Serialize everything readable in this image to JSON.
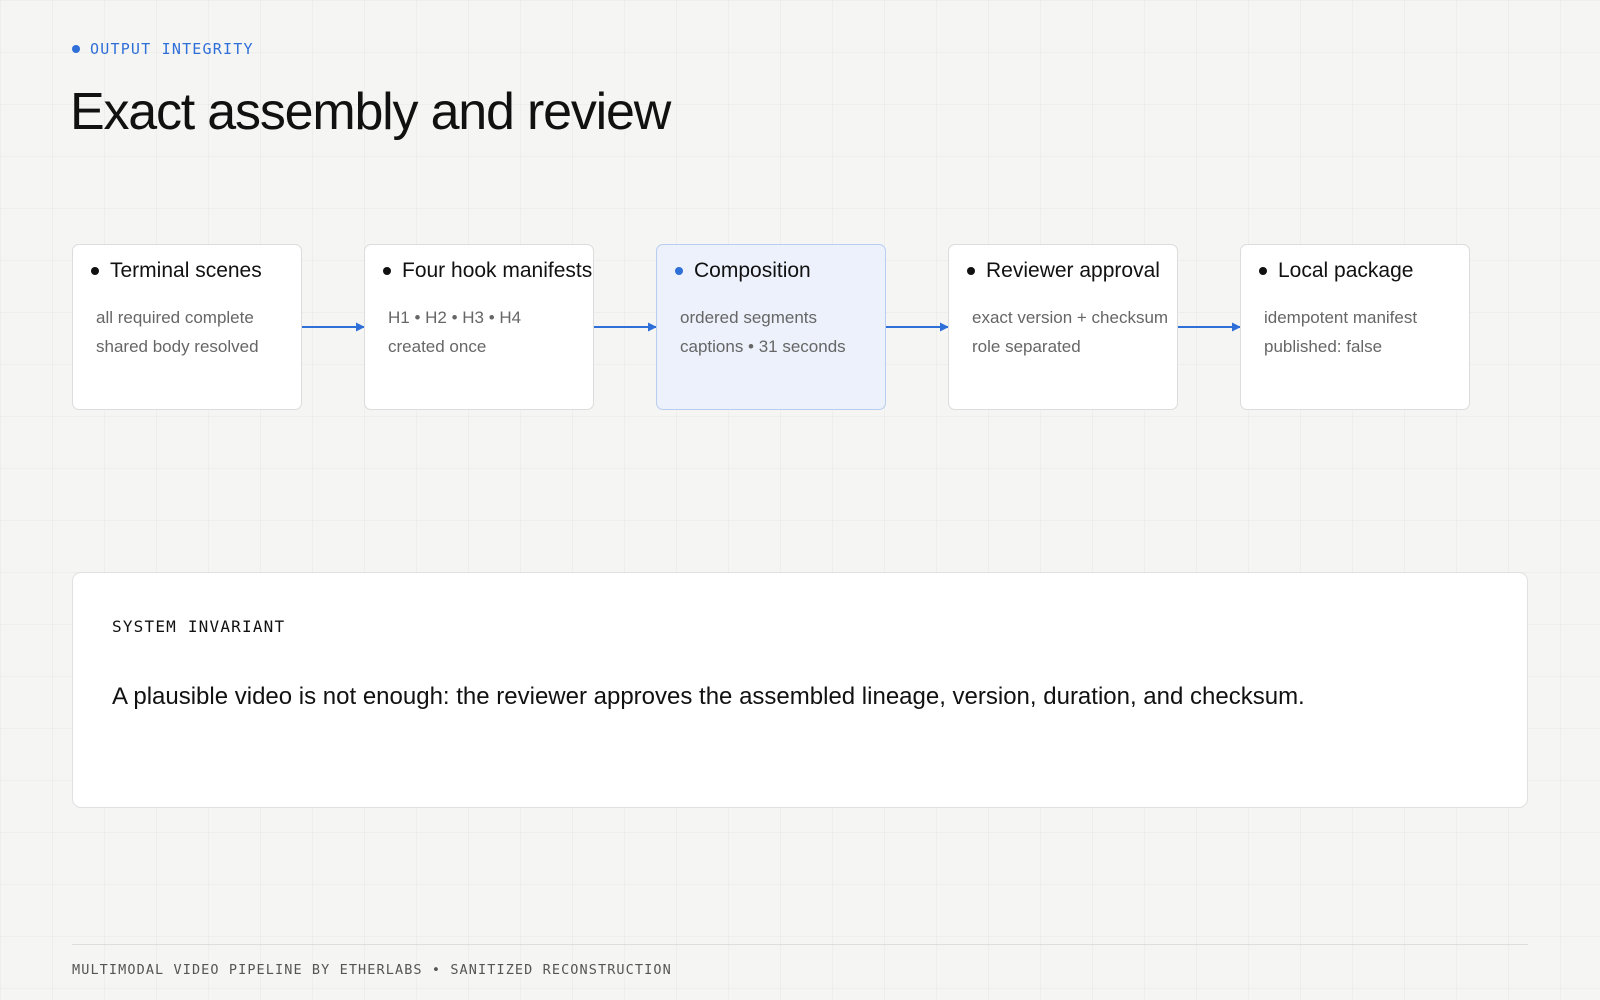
{
  "header": {
    "eyebrow": "OUTPUT INTEGRITY",
    "title": "Exact assembly and review"
  },
  "colors": {
    "accent": "#2f6fd8",
    "highlight_fill": "#ecf1fb",
    "highlight_border": "#b8cdef",
    "node_border": "#dcdcdc",
    "background": "#f5f5f3"
  },
  "pipeline": {
    "steps": [
      {
        "title": "Terminal scenes",
        "lines": [
          "all required complete",
          "shared body resolved"
        ],
        "highlighted": false
      },
      {
        "title": "Four hook manifests",
        "lines": [
          "H1 • H2 • H3 • H4",
          "created once"
        ],
        "highlighted": false
      },
      {
        "title": "Composition",
        "lines": [
          "ordered segments",
          "captions • 31 seconds"
        ],
        "highlighted": true
      },
      {
        "title": "Reviewer approval",
        "lines": [
          "exact version + checksum",
          "role separated"
        ],
        "highlighted": false
      },
      {
        "title": "Local package",
        "lines": [
          "idempotent manifest",
          "published: false"
        ],
        "highlighted": false
      }
    ],
    "connector_icon": "arrow-right-icon"
  },
  "invariant": {
    "label": "SYSTEM INVARIANT",
    "text": "A plausible video is not enough: the reviewer approves the assembled lineage, version, duration, and checksum."
  },
  "footer": {
    "text": "MULTIMODAL VIDEO PIPELINE BY ETHERLABS • SANITIZED RECONSTRUCTION"
  }
}
